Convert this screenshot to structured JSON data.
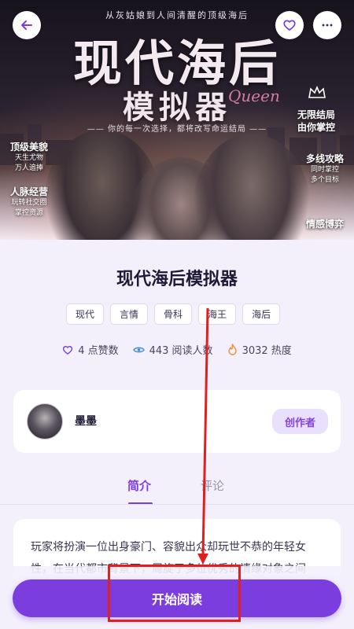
{
  "cover": {
    "tagline": "从灰姑娘到人间清醒的顶级海后",
    "title_line1": "现代海后",
    "title_line2": "模拟器",
    "script_word": "Queen",
    "subtitle": "—— 你的每一次选择，都将改写命运结局 ——",
    "badge_line1": "无限结局",
    "badge_line2": "由你掌控",
    "left_labels": [
      {
        "heading": "顶级美貌",
        "lines": [
          "天生尤物",
          "万人追捧"
        ]
      },
      {
        "heading": "人脉经营",
        "lines": [
          "玩转社交圈",
          "掌控资源"
        ]
      }
    ],
    "right_labels": [
      {
        "heading": "多线攻略",
        "lines": [
          "同时掌控",
          "多个目标"
        ]
      },
      {
        "heading": "情感博弈",
        "lines": []
      }
    ]
  },
  "book": {
    "title": "现代海后模拟器",
    "tags": [
      "现代",
      "言情",
      "骨科",
      "海王",
      "海后"
    ]
  },
  "stats": {
    "likes": "4 点赞数",
    "reads": "443 阅读人数",
    "heat": "3032 热度"
  },
  "creator": {
    "name": "墨墨",
    "badge": "创作者"
  },
  "tabs": {
    "intro": "简介",
    "comments": "评论"
  },
  "intro": {
    "text": "玩家将扮演一位出身豪门、容貌出众却玩世不恭的年轻女性，在当代都市背景下，周旋于多位优秀的情缘对象之间"
  },
  "actions": {
    "start_reading": "开始阅读"
  },
  "colors": {
    "accent": "#7c3ddf",
    "annotation": "#e02020"
  }
}
